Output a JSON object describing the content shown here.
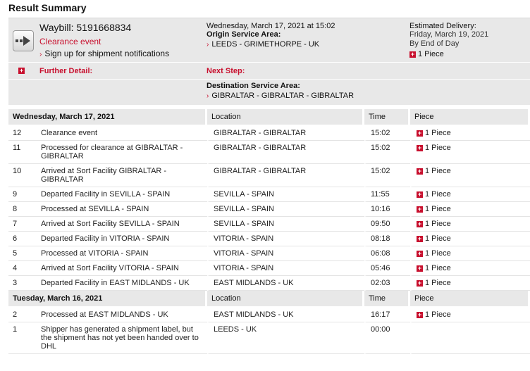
{
  "title": "Result Summary",
  "summary": {
    "waybill": "Waybill: 5191668834",
    "status": "Clearance event",
    "signup": "Sign up for shipment notifications",
    "datetime": "Wednesday, March 17, 2021 at 15:02",
    "origin_label": "Origin Service Area:",
    "origin_value": "LEEDS - GRIMETHORPE - UK",
    "est_label": "Estimated Delivery:",
    "est_date": "Friday, March 19, 2021",
    "est_eod": "By End of Day",
    "est_piece": "1 Piece",
    "further_detail": "Further Detail:",
    "next_step": "Next Step:",
    "dest_label": "Destination Service Area:",
    "dest_value": "GIBRALTAR - GIBRALTAR - GIBRALTAR"
  },
  "columns": {
    "location": "Location",
    "time": "Time",
    "piece": "Piece"
  },
  "groups": [
    {
      "date": "Wednesday, March 17, 2021",
      "rows": [
        {
          "n": "12",
          "desc": "Clearance event",
          "loc": "GIBRALTAR - GIBRALTAR",
          "time": "15:02",
          "piece": "1 Piece"
        },
        {
          "n": "11",
          "desc": "Processed for clearance at GIBRALTAR - GIBRALTAR",
          "loc": "GIBRALTAR - GIBRALTAR",
          "time": "15:02",
          "piece": "1 Piece"
        },
        {
          "n": "10",
          "desc": "Arrived at Sort Facility GIBRALTAR - GIBRALTAR",
          "loc": "GIBRALTAR - GIBRALTAR",
          "time": "15:02",
          "piece": "1 Piece"
        },
        {
          "n": "9",
          "desc": "Departed Facility in SEVILLA - SPAIN",
          "loc": "SEVILLA - SPAIN",
          "time": "11:55",
          "piece": "1 Piece"
        },
        {
          "n": "8",
          "desc": "Processed at SEVILLA - SPAIN",
          "loc": "SEVILLA - SPAIN",
          "time": "10:16",
          "piece": "1 Piece"
        },
        {
          "n": "7",
          "desc": "Arrived at Sort Facility SEVILLA - SPAIN",
          "loc": "SEVILLA - SPAIN",
          "time": "09:50",
          "piece": "1 Piece"
        },
        {
          "n": "6",
          "desc": "Departed Facility in VITORIA - SPAIN",
          "loc": "VITORIA - SPAIN",
          "time": "08:18",
          "piece": "1 Piece"
        },
        {
          "n": "5",
          "desc": "Processed at VITORIA - SPAIN",
          "loc": "VITORIA - SPAIN",
          "time": "06:08",
          "piece": "1 Piece"
        },
        {
          "n": "4",
          "desc": "Arrived at Sort Facility VITORIA - SPAIN",
          "loc": "VITORIA - SPAIN",
          "time": "05:46",
          "piece": "1 Piece"
        },
        {
          "n": "3",
          "desc": "Departed Facility in EAST MIDLANDS - UK",
          "loc": "EAST MIDLANDS - UK",
          "time": "02:03",
          "piece": "1 Piece"
        }
      ]
    },
    {
      "date": "Tuesday, March 16, 2021",
      "rows": [
        {
          "n": "2",
          "desc": "Processed at EAST MIDLANDS - UK",
          "loc": "EAST MIDLANDS - UK",
          "time": "16:17",
          "piece": "1 Piece"
        },
        {
          "n": "1",
          "desc": "Shipper has generated a shipment label, but the shipment has not yet been handed over to DHL",
          "loc": "LEEDS - UK",
          "time": "00:00",
          "piece": ""
        }
      ]
    }
  ]
}
